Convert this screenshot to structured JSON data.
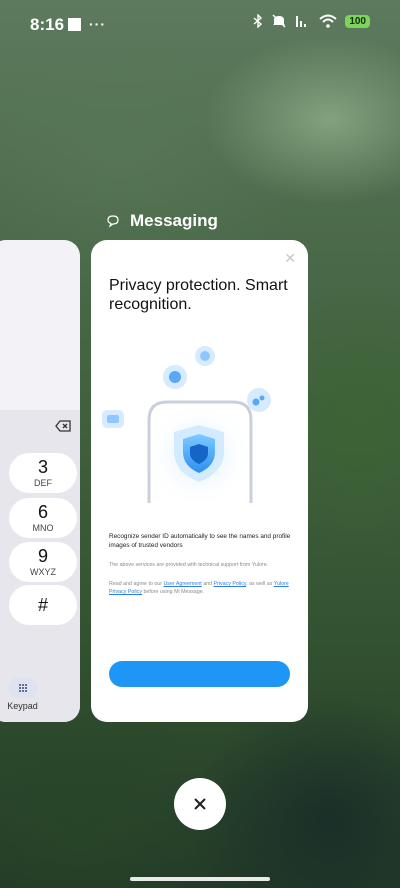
{
  "status_bar": {
    "time": "8:16",
    "dots": "···",
    "battery": "100"
  },
  "app_label": {
    "name": "Messaging"
  },
  "dialer_card": {
    "keys": [
      {
        "num": "3",
        "letters": "DEF"
      },
      {
        "num": "6",
        "letters": "MNO"
      },
      {
        "num": "9",
        "letters": "WXYZ"
      },
      {
        "num": "#",
        "letters": ""
      }
    ],
    "keypad_label": "Keypad"
  },
  "messaging_card": {
    "headline": "Privacy protection. Smart recognition.",
    "description": "Recognize sender ID automatically to see the names and profile images of trusted vendors",
    "provider_note": "The above services are provided with technical support from Yulore.",
    "agree_prefix": "Read and agree to our ",
    "user_agreement": "User Agreement",
    "and": " and ",
    "privacy_policy": "Privacy Policy",
    "as_well_as": ", as well as ",
    "yulore_policy": "Yulore Privacy Policy",
    "agree_suffix": " before using Mi Message."
  },
  "colors": {
    "accent": "#1e96f5",
    "link": "#2f7de8",
    "battery": "#7dd35b"
  }
}
